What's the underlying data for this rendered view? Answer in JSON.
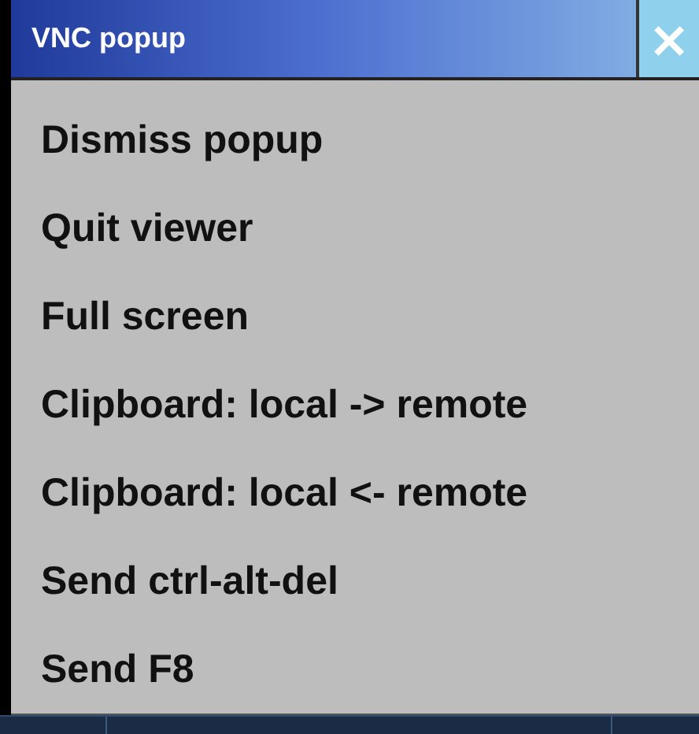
{
  "window": {
    "title": "VNC popup",
    "close": "×"
  },
  "menu": {
    "items": [
      {
        "label": "Dismiss popup"
      },
      {
        "label": "Quit viewer"
      },
      {
        "label": "Full screen"
      },
      {
        "label": "Clipboard: local -> remote"
      },
      {
        "label": "Clipboard: local <- remote"
      },
      {
        "label": "Send ctrl-alt-del"
      },
      {
        "label": "Send F8"
      }
    ]
  }
}
